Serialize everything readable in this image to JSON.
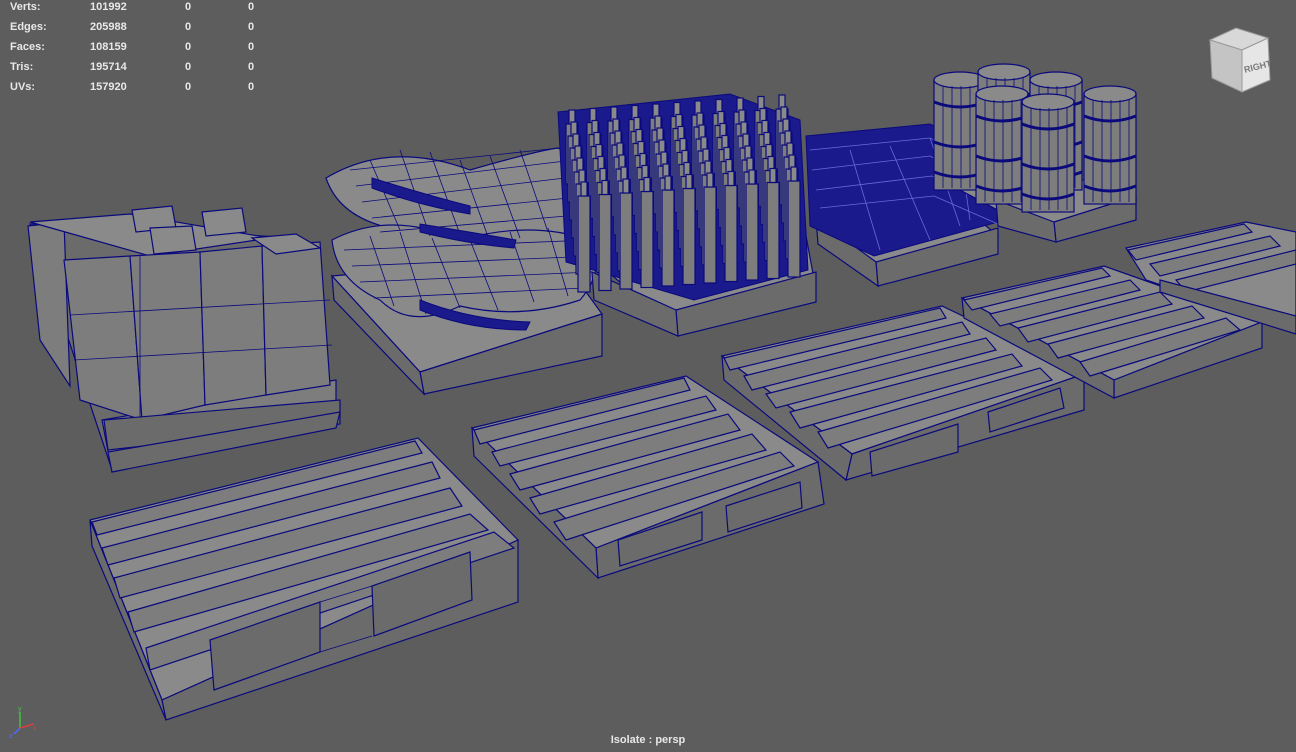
{
  "hud": {
    "rows": [
      {
        "label": "Verts:",
        "v1": "101992",
        "v2": "0",
        "v3": "0"
      },
      {
        "label": "Edges:",
        "v1": "205988",
        "v2": "0",
        "v3": "0"
      },
      {
        "label": "Faces:",
        "v1": "108159",
        "v2": "0",
        "v3": "0"
      },
      {
        "label": "Tris:",
        "v1": "195714",
        "v2": "0",
        "v3": "0"
      },
      {
        "label": "UVs:",
        "v1": "157920",
        "v2": "0",
        "v3": "0"
      }
    ]
  },
  "viewcube": {
    "face_label": "RIGHT"
  },
  "axis": {
    "x": "x",
    "y": "y",
    "z": "z"
  },
  "camera": {
    "label": "Isolate : persp"
  },
  "colors": {
    "background": "#5d5d5d",
    "mesh": "#7d7d7d",
    "wireframe": "#0a0a7c",
    "hud_text": "#e8e8e8"
  }
}
